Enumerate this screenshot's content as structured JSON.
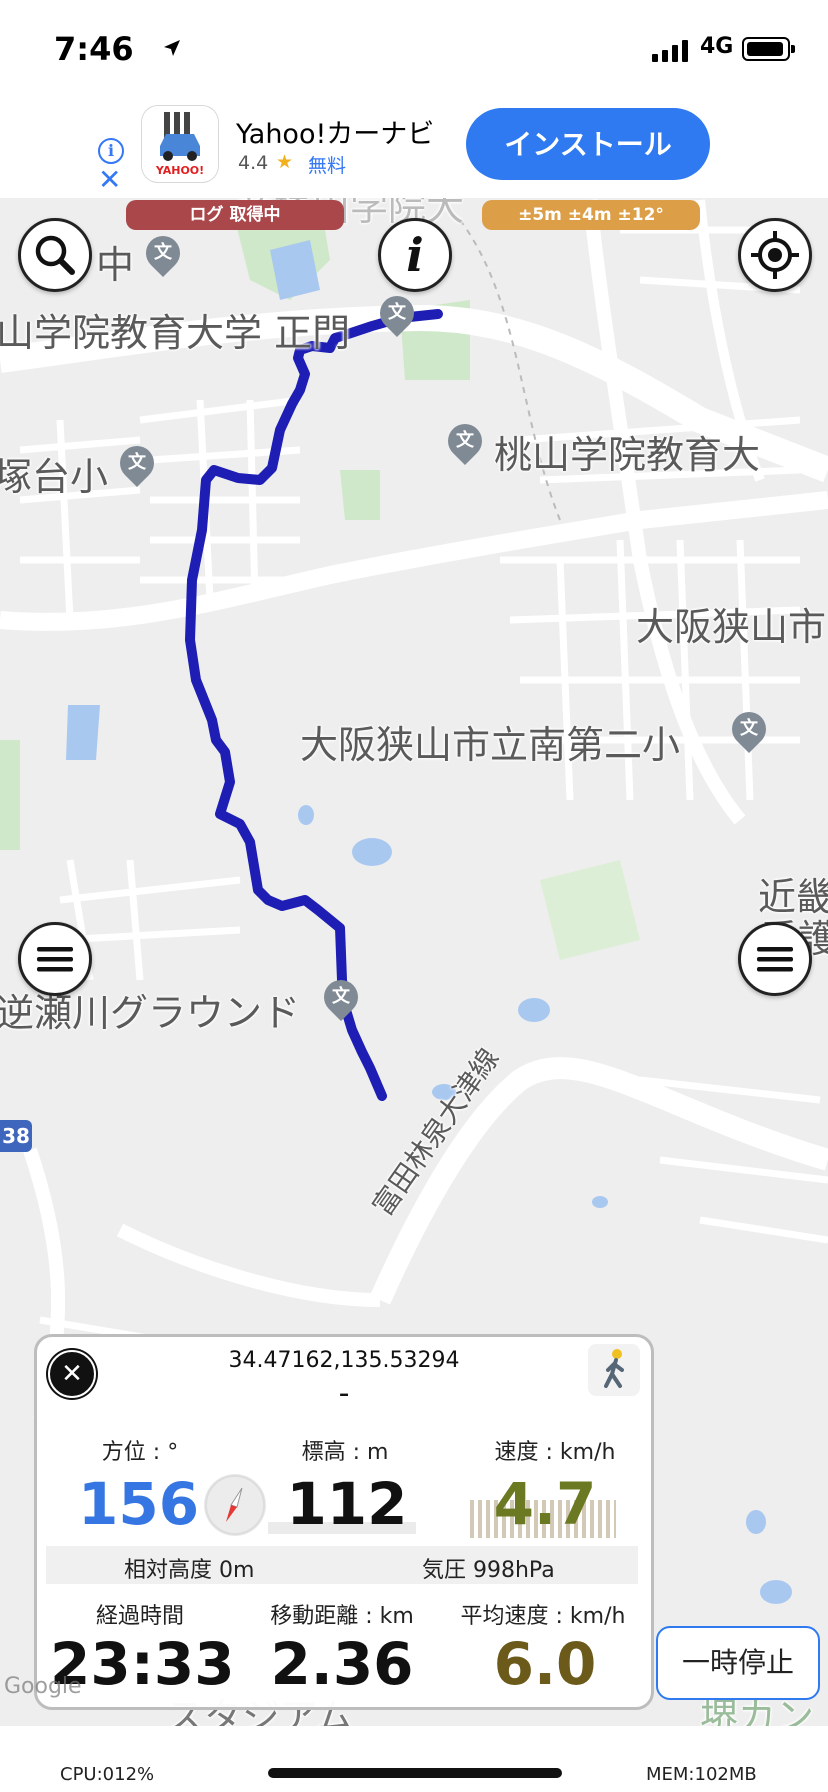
{
  "status": {
    "time": "7:46",
    "network": "4G"
  },
  "ad": {
    "app_name": "Yahoo!カーナビ",
    "rating": "4.4",
    "star": "★",
    "price": "無料",
    "install_label": "インストール",
    "icon_text": "YAHOO!",
    "info_glyph": "i",
    "close_glyph": "✕"
  },
  "map": {
    "badges": {
      "log": "ログ 取得中",
      "accuracy": "±5m ±4m ±12°"
    },
    "labels": {
      "top_faded": "帝塚山学院大",
      "main_gate": "山学院教育大学 正門",
      "school_left": "塚台小",
      "momoyama": "桃山学院教育大",
      "osakasayama": "大阪狭山市",
      "minami": "大阪狭山市立南第二小",
      "kinki": "近畿",
      "kango": "看護",
      "ground": "逆瀬川グラウンド",
      "route_line": "富田林泉大津線",
      "chu": "中",
      "stadium": "スタジアム",
      "sakai": "堺カン"
    },
    "route_number": "38",
    "pin_glyph": "文"
  },
  "panel": {
    "coords": "34.47162,135.53294",
    "place": "-",
    "direction": {
      "label": "方位 : °",
      "value": "156"
    },
    "altitude": {
      "label": "標高 : m",
      "value": "112"
    },
    "speed": {
      "label": "速度 : km/h",
      "value": "4.7"
    },
    "relative_altitude": "相対高度 0m",
    "pressure": "気圧 998hPa",
    "elapsed": {
      "label": "経過時間",
      "value": "23:33"
    },
    "distance": {
      "label": "移動距離 : km",
      "value": "2.36"
    },
    "avg_speed": {
      "label": "平均速度 : km/h",
      "value": "6.0"
    },
    "close_glyph": "✕"
  },
  "pause_label": "一時停止",
  "footer": {
    "cpu": "CPU:012%",
    "mem": "MEM:102MB",
    "google": "Google"
  },
  "colors": {
    "route": "#1e1eb4",
    "accent_blue": "#2f7af0",
    "log_badge": "#a9474a",
    "accuracy_badge": "#dc9f48",
    "direction_value": "#3576e2",
    "speed_value": "#6b7a22",
    "avg_value": "#6b5a1a"
  }
}
